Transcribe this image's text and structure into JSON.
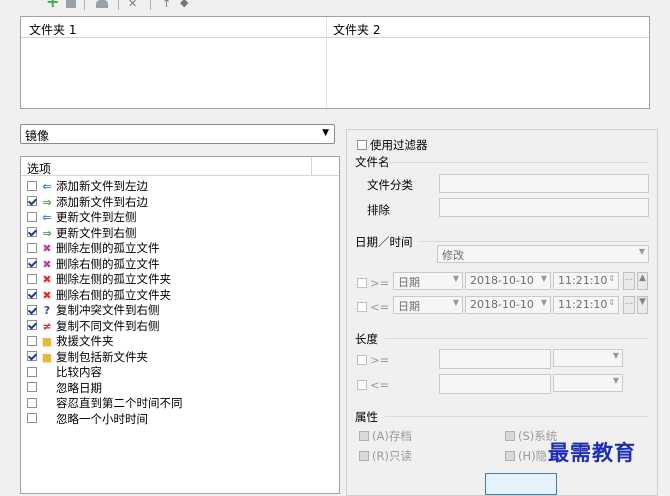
{
  "folder_pairs": {
    "col1": "文件夹 1",
    "col2": "文件夹 2"
  },
  "mode_select": {
    "value": "镜像"
  },
  "options": {
    "header": "选项",
    "items": [
      {
        "label": "添加新文件到左边",
        "checked": false,
        "icon": "arrow-left-new-icon",
        "icon_color": "#2e7bd6"
      },
      {
        "label": "添加新文件到右边",
        "checked": true,
        "icon": "arrow-right-new-icon",
        "icon_color": "#3aa63a"
      },
      {
        "label": "更新文件到左侧",
        "checked": false,
        "icon": "arrow-left-update-icon",
        "icon_color": "#2e7bd6"
      },
      {
        "label": "更新文件到右侧",
        "checked": true,
        "icon": "arrow-right-update-icon",
        "icon_color": "#3aa63a"
      },
      {
        "label": "删除左侧的孤立文件",
        "checked": false,
        "icon": "delete-left-icon",
        "icon_color": "#c63aa0"
      },
      {
        "label": "删除右侧的孤立文件",
        "checked": true,
        "icon": "delete-right-icon",
        "icon_color": "#c63aa0"
      },
      {
        "label": "删除左侧的孤立文件夹",
        "checked": false,
        "icon": "delete-folder-left-icon",
        "icon_color": "#e03030"
      },
      {
        "label": "删除右侧的孤立文件夹",
        "checked": true,
        "icon": "delete-folder-right-icon",
        "icon_color": "#e03030"
      },
      {
        "label": "复制冲突文件到右侧",
        "checked": true,
        "icon": "question-icon",
        "icon_color": "#1f4fc9"
      },
      {
        "label": "复制不同文件到右侧",
        "checked": true,
        "icon": "not-equal-icon",
        "icon_color": "#d42a2a"
      },
      {
        "label": "救援文件夹",
        "checked": false,
        "icon": "folder-icon",
        "icon_color": "#e8b83a"
      },
      {
        "label": "复制包括新文件夹",
        "checked": true,
        "icon": "new-folder-icon",
        "icon_color": "#e8b83a"
      },
      {
        "label": "比较内容",
        "checked": false,
        "icon": "",
        "icon_color": ""
      },
      {
        "label": "忽略日期",
        "checked": false,
        "icon": "",
        "icon_color": ""
      },
      {
        "label": "容忍直到第二个时间不同",
        "checked": false,
        "icon": "",
        "icon_color": ""
      },
      {
        "label": "忽略一个小时时间",
        "checked": false,
        "icon": "",
        "icon_color": ""
      }
    ]
  },
  "filter": {
    "use_filter": "使用过滤器",
    "filename_section": "文件名",
    "file_class": "文件分类",
    "exclude": "排除",
    "datetime_section": "日期／时间",
    "datetime_type": "修改",
    "row1": {
      "op": ">=",
      "kind": "日期",
      "date": "2018-10-10",
      "time": "11:21:10"
    },
    "row2": {
      "op": "<=",
      "kind": "日期",
      "date": "2018-10-10",
      "time": "11:21:10"
    },
    "more_button": "...",
    "length_section": "长度",
    "len_ge": ">=",
    "len_le": "<=",
    "attr_section": "属性",
    "attr_archive": "(A)存档",
    "attr_readonly": "(R)只读",
    "attr_system": "(S)系统",
    "attr_hidden": "(H)隐"
  },
  "watermark": "最需教育"
}
